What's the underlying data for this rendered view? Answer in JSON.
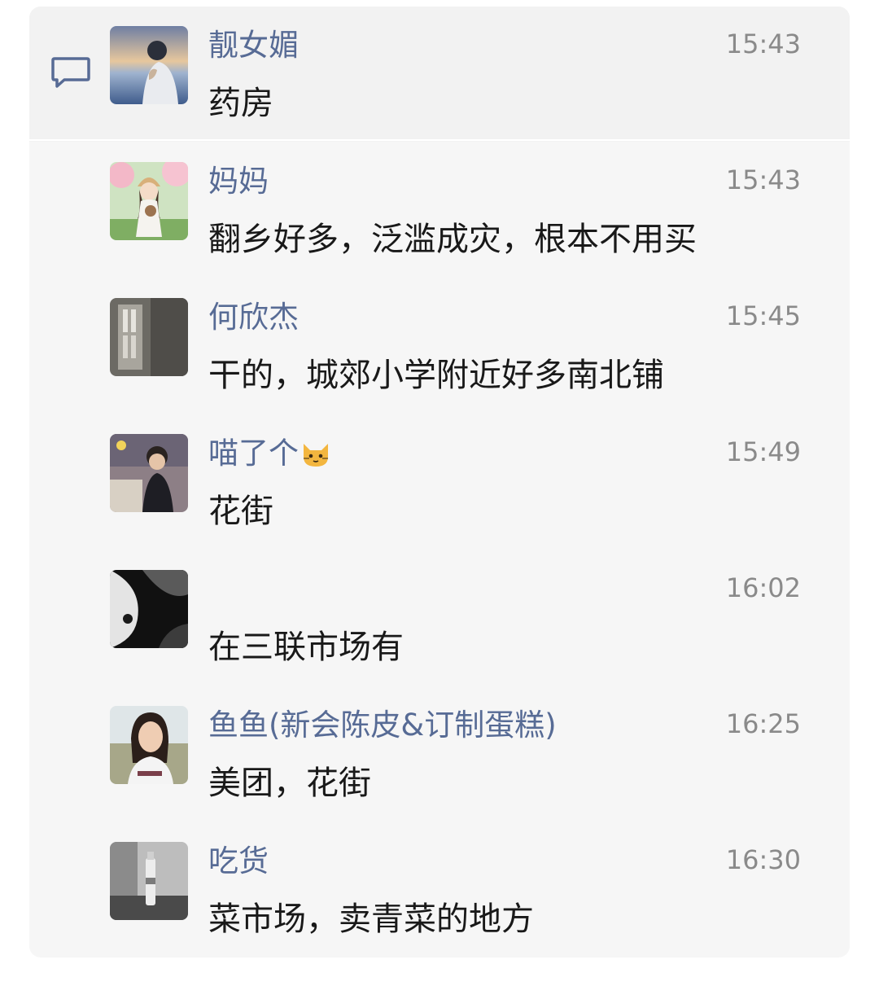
{
  "messages": [
    {
      "name": "靓女媚",
      "time": "15:43",
      "text": "药房",
      "avatar": "avatar-sunset-girl"
    },
    {
      "name": "妈妈",
      "time": "15:43",
      "text": "翻乡好多，泛滥成灾，根本不用买",
      "avatar": "avatar-anime-girl-garden"
    },
    {
      "name": "何欣杰",
      "time": "15:45",
      "text": "干的，城郊小学附近好多南北铺",
      "avatar": "avatar-window-shadow"
    },
    {
      "name": "喵了个",
      "time": "15:49",
      "text": "花街",
      "avatar": "avatar-child-photo",
      "name_emoji": "cat-face-icon"
    },
    {
      "name": "",
      "time": "16:02",
      "text": "在三联市场有",
      "avatar": "avatar-dark-abstract"
    },
    {
      "name": "鱼鱼(新会陈皮&订制蛋糕)",
      "time": "16:25",
      "text": "美团，花街",
      "avatar": "avatar-woman-portrait"
    },
    {
      "name": "吃货",
      "time": "16:30",
      "text": "菜市场，卖青菜的地方",
      "avatar": "avatar-grayscale-bottle"
    }
  ],
  "colors": {
    "name": "#576b95",
    "time": "#8a8a8a",
    "message": "#191919",
    "panel": "#f6f6f6"
  },
  "icons": {
    "reply": "comment-bubble-icon"
  }
}
